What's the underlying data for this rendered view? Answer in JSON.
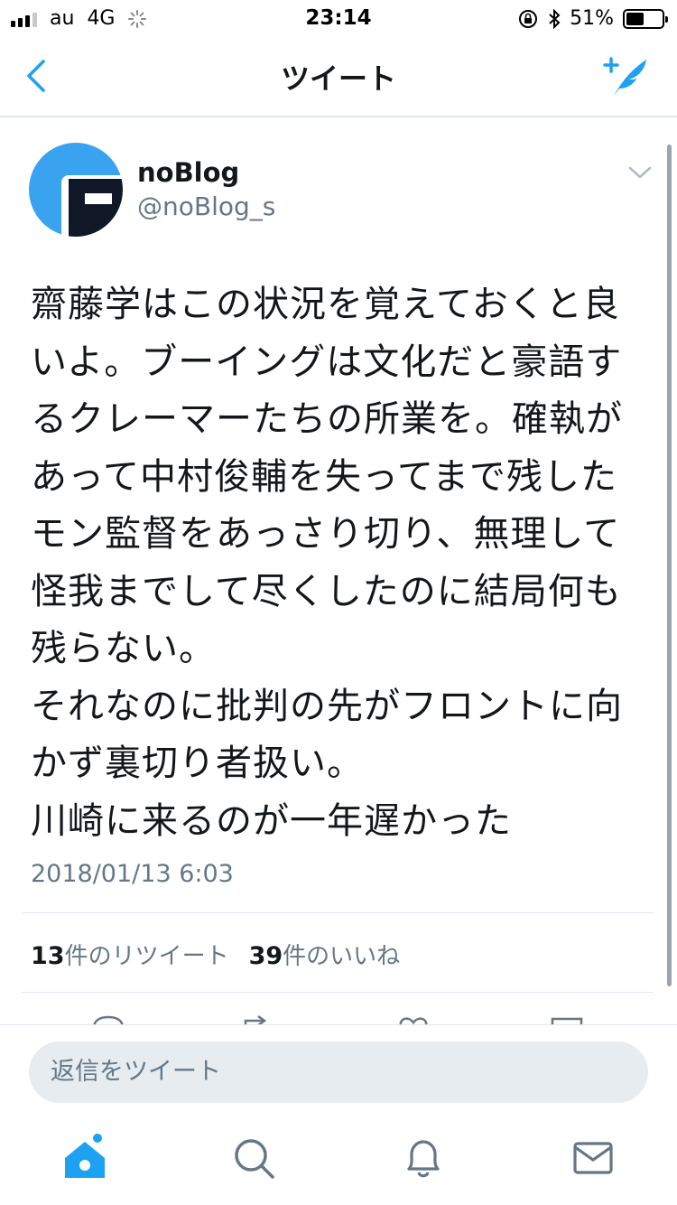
{
  "status_bar": {
    "carrier": "au",
    "network": "4G",
    "time": "23:14",
    "battery": "51%",
    "battery_fraction": 0.51
  },
  "nav": {
    "title": "ツイート",
    "back_icon": "chevron-left-icon",
    "compose_icon": "compose-tweet-icon"
  },
  "tweet": {
    "display_name": "noBlog",
    "handle": "@noBlog_s",
    "text": "齋藤学はこの状況を覚えておくと良いよ。ブーイングは文化だと豪語するクレーマーたちの所業を。確執があって中村俊輔を失ってまで残したモン監督をあっさり切り、無理して怪我までして尽くしたのに結局何も残らない。\nそれなのに批判の先がフロントに向かず裏切り者扱い。\n川崎に来るのが一年遅かった",
    "timestamp": "2018/01/13 6:03",
    "retweets": {
      "count": "13",
      "label": "件のリツイート"
    },
    "likes": {
      "count": "39",
      "label": "件のいいね"
    }
  },
  "reply": {
    "placeholder": "返信をツイート"
  },
  "tab_bar": {
    "items": [
      "home-icon",
      "search-icon",
      "notifications-icon",
      "messages-icon"
    ]
  },
  "colors": {
    "brand": "#1da1f2",
    "text": "#14171a",
    "secondary": "#657786"
  }
}
